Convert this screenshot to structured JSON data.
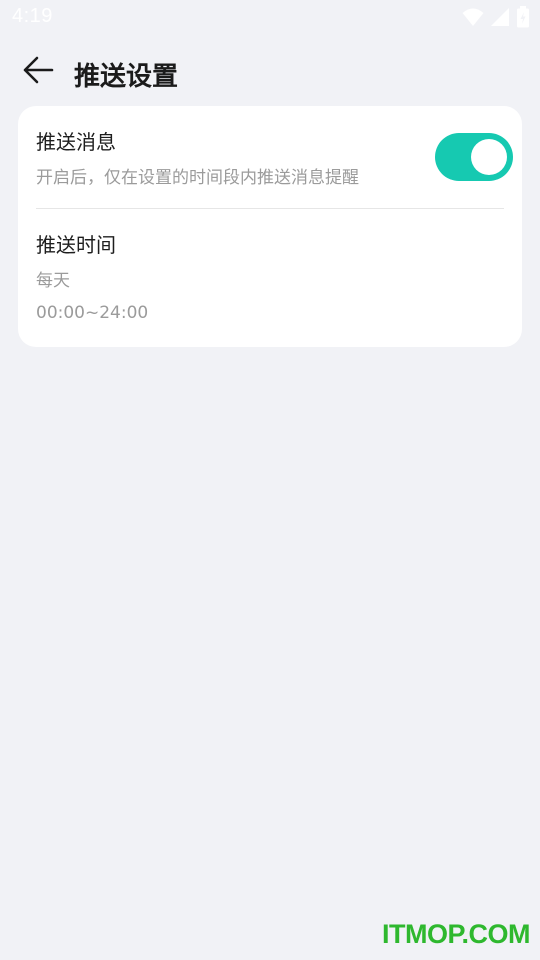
{
  "status_bar": {
    "time": "4:19",
    "icons": [
      "wifi-icon",
      "signal-icon",
      "battery-icon"
    ]
  },
  "header": {
    "back_icon": "back-arrow-icon",
    "title": "推送设置"
  },
  "settings": {
    "push_message": {
      "title": "推送消息",
      "description": "开启后，仅在设置的时间段内推送消息提醒",
      "enabled": true
    },
    "push_time": {
      "title": "推送时间",
      "frequency": "每天",
      "range": "00:00~24:00"
    }
  },
  "watermark": {
    "text": "ITMOP.COM"
  },
  "colors": {
    "background": "#f1f2f6",
    "card": "#ffffff",
    "toggle_on": "#16c9b1",
    "watermark": "#2eb82e"
  }
}
